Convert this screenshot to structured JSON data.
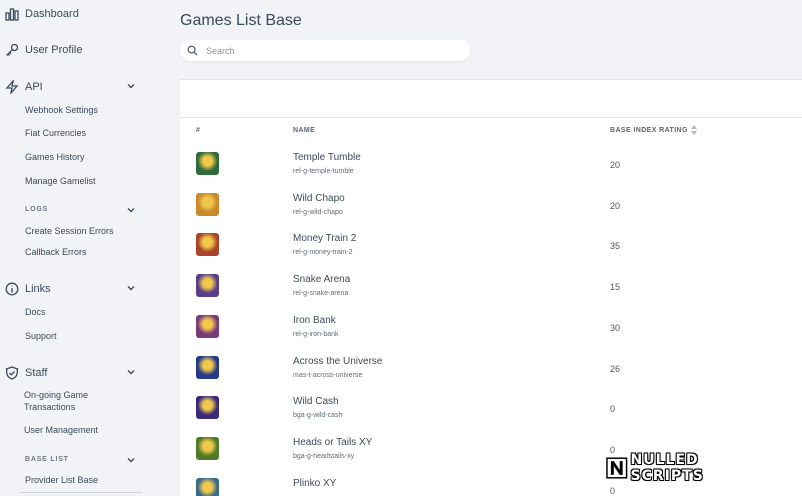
{
  "sidebar": {
    "dashboard": "Dashboard",
    "user_profile": "User Profile",
    "api": {
      "label": "API",
      "items": [
        "Webhook Settings",
        "Fiat Currencies",
        "Games History",
        "Manage Gamelist"
      ]
    },
    "logs": {
      "label": "LOGS",
      "items": [
        "Create Session Errors",
        "Callback Errors"
      ]
    },
    "links": {
      "label": "Links",
      "items": [
        "Docs",
        "Support"
      ]
    },
    "staff": {
      "label": "Staff",
      "items": [
        "On-going Game Transactions",
        "User Management"
      ]
    },
    "base_list": {
      "label": "BASE LIST",
      "items": [
        "Provider List Base"
      ]
    }
  },
  "main": {
    "title": "Games List Base",
    "search_placeholder": "Search",
    "columns": {
      "index": "#",
      "name": "NAME",
      "rating": "BASE INDEX RATING"
    },
    "rows": [
      {
        "name": "Temple Tumble",
        "slug": "rel-g-temple-tumble",
        "rating": "20",
        "thumb": "#2f6a3a"
      },
      {
        "name": "Wild Chapo",
        "slug": "rel-g-wild-chapo",
        "rating": "20",
        "thumb": "#c9892b"
      },
      {
        "name": "Money Train 2",
        "slug": "rel-g-money-train-2",
        "rating": "35",
        "thumb": "#a8442a"
      },
      {
        "name": "Snake Arena",
        "slug": "rel-g-snake-arena",
        "rating": "15",
        "thumb": "#5a3e8c"
      },
      {
        "name": "Iron Bank",
        "slug": "rel-g-iron-bank",
        "rating": "30",
        "thumb": "#7a3b7e"
      },
      {
        "name": "Across the Universe",
        "slug": "mas-t-across-universe",
        "rating": "26",
        "thumb": "#253a8a"
      },
      {
        "name": "Wild Cash",
        "slug": "bga-g-wild-cash",
        "rating": "0",
        "thumb": "#3b2a7a"
      },
      {
        "name": "Heads or Tails XY",
        "slug": "bga-g-headstails-xy",
        "rating": "0",
        "thumb": "#4f7a2a"
      },
      {
        "name": "Plinko XY",
        "slug": "",
        "rating": "0",
        "thumb": "#3a6a8a"
      }
    ]
  },
  "watermark": "NULLED SCRIPTS",
  "colors": {
    "background": "#f2f3f6",
    "text": "#3b4a5a",
    "panel": "#ffffff"
  }
}
